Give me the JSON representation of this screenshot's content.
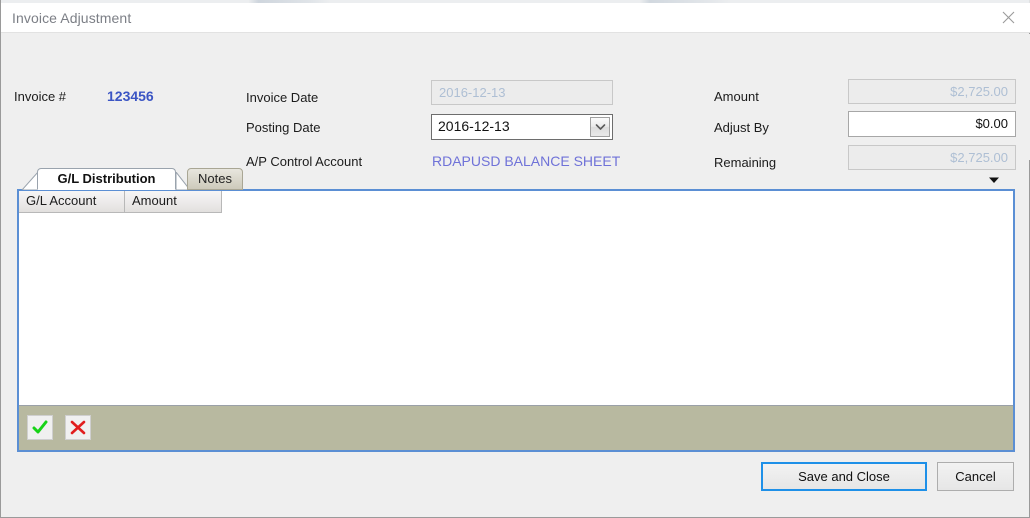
{
  "window": {
    "title": "Invoice Adjustment",
    "close_icon": "close-icon"
  },
  "form": {
    "invoice_number": {
      "label": "Invoice #",
      "value": "123456"
    },
    "invoice_date": {
      "label": "Invoice Date",
      "value": "2016-12-13",
      "state": "disabled"
    },
    "posting_date": {
      "label": "Posting Date",
      "value": "2016-12-13",
      "state": "combobox"
    },
    "ap_control_account": {
      "label": "A/P Control Account",
      "value": "RDAPUSD BALANCE SHEET"
    },
    "amount": {
      "label": "Amount",
      "value": "$2,725.00",
      "state": "disabled"
    },
    "adjust_by": {
      "label": "Adjust By",
      "value": "$0.00",
      "state": "editable"
    },
    "remaining": {
      "label": "Remaining",
      "value": "$2,725.00",
      "state": "disabled"
    }
  },
  "tabs": {
    "items": [
      {
        "label": "G/L Distribution",
        "active": true
      },
      {
        "label": "Notes",
        "active": false
      }
    ],
    "overflow_icon": "chevron-down-icon"
  },
  "grid": {
    "columns": [
      "G/L Account",
      "Amount"
    ],
    "rows": [],
    "toolbar": {
      "accept_icon": "check-icon",
      "cancel_icon": "cross-icon"
    }
  },
  "footer": {
    "save_label": "Save and Close",
    "cancel_label": "Cancel"
  },
  "colors": {
    "accent_blue": "#5b8fd4",
    "focus_blue": "#1e90e8",
    "link_blue": "#6f72d8",
    "value_blue": "#3b55c4",
    "toolbar_khaki": "#b8b9a0",
    "disabled_text": "#aebfd4"
  }
}
